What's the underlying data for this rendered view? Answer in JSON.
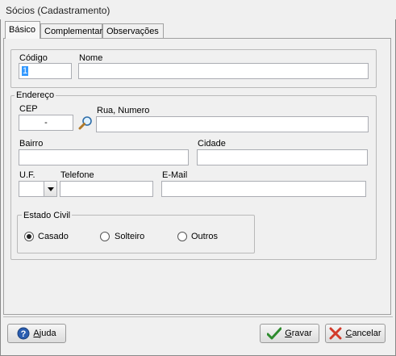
{
  "window": {
    "title": "Sócios (Cadastramento)"
  },
  "tabs": [
    {
      "label": "Básico"
    },
    {
      "label": "Complementar"
    },
    {
      "label": "Observações"
    }
  ],
  "form": {
    "codigo": {
      "label": "Código",
      "value": "1"
    },
    "nome": {
      "label": "Nome",
      "value": ""
    },
    "endereco": {
      "legend": "Endereço",
      "cep": {
        "label": "CEP",
        "value": "-"
      },
      "rua": {
        "label": "Rua, Numero",
        "value": ""
      },
      "bairro": {
        "label": "Bairro",
        "value": ""
      },
      "cidade": {
        "label": "Cidade",
        "value": ""
      },
      "uf": {
        "label": "U.F.",
        "value": ""
      },
      "telefone": {
        "label": "Telefone",
        "value": ""
      },
      "email": {
        "label": "E-Mail",
        "value": ""
      },
      "estado_civil": {
        "legend": "Estado Civil",
        "options": [
          {
            "label": "Casado",
            "selected": true
          },
          {
            "label": "Solteiro",
            "selected": false
          },
          {
            "label": "Outros",
            "selected": false
          }
        ]
      }
    }
  },
  "footer": {
    "help_label_first": "A",
    "help_label_rest": "juda",
    "save_label_first": "G",
    "save_label_rest": "ravar",
    "cancel_label_first": "C",
    "cancel_label_rest": "ancelar"
  },
  "icons": {
    "search": "magnifier-icon",
    "help": "help-icon",
    "save": "checkmark-icon",
    "cancel": "cross-icon",
    "dropdown": "chevron-down-icon"
  },
  "colors": {
    "selection": "#3399ff",
    "save_check": "#2e8b2e",
    "cancel_x": "#d23a2a",
    "help_blue": "#2a5db0"
  }
}
